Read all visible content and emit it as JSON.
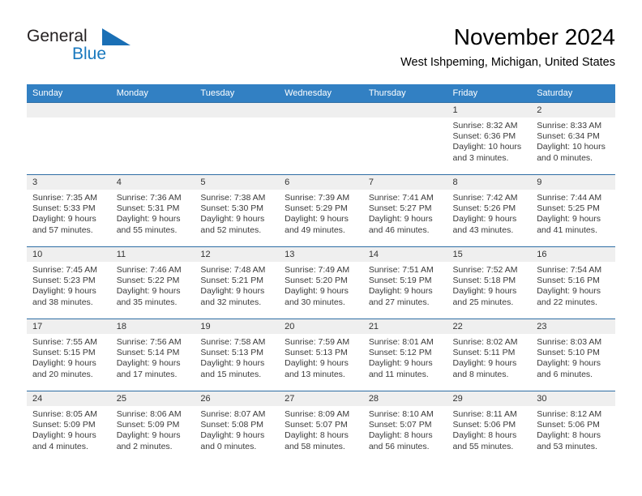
{
  "brand": {
    "name_part1": "General",
    "name_part2": "Blue",
    "mark": "triangle-logo"
  },
  "header": {
    "title": "November 2024",
    "location": "West Ishpeming, Michigan, United States"
  },
  "colors": {
    "header_blue": "#3280c3",
    "row_border_blue": "#2e6da4",
    "date_band_gray": "#efefef",
    "brand_blue": "#1878be"
  },
  "weekdays": [
    "Sunday",
    "Monday",
    "Tuesday",
    "Wednesday",
    "Thursday",
    "Friday",
    "Saturday"
  ],
  "weeks": [
    [
      {
        "date": "",
        "empty": true,
        "sunrise": "",
        "sunset": "",
        "daylight": ""
      },
      {
        "date": "",
        "empty": true,
        "sunrise": "",
        "sunset": "",
        "daylight": ""
      },
      {
        "date": "",
        "empty": true,
        "sunrise": "",
        "sunset": "",
        "daylight": ""
      },
      {
        "date": "",
        "empty": true,
        "sunrise": "",
        "sunset": "",
        "daylight": ""
      },
      {
        "date": "",
        "empty": true,
        "sunrise": "",
        "sunset": "",
        "daylight": ""
      },
      {
        "date": "1",
        "empty": false,
        "sunrise": "Sunrise: 8:32 AM",
        "sunset": "Sunset: 6:36 PM",
        "daylight": "Daylight: 10 hours and 3 minutes."
      },
      {
        "date": "2",
        "empty": false,
        "sunrise": "Sunrise: 8:33 AM",
        "sunset": "Sunset: 6:34 PM",
        "daylight": "Daylight: 10 hours and 0 minutes."
      }
    ],
    [
      {
        "date": "3",
        "empty": false,
        "sunrise": "Sunrise: 7:35 AM",
        "sunset": "Sunset: 5:33 PM",
        "daylight": "Daylight: 9 hours and 57 minutes."
      },
      {
        "date": "4",
        "empty": false,
        "sunrise": "Sunrise: 7:36 AM",
        "sunset": "Sunset: 5:31 PM",
        "daylight": "Daylight: 9 hours and 55 minutes."
      },
      {
        "date": "5",
        "empty": false,
        "sunrise": "Sunrise: 7:38 AM",
        "sunset": "Sunset: 5:30 PM",
        "daylight": "Daylight: 9 hours and 52 minutes."
      },
      {
        "date": "6",
        "empty": false,
        "sunrise": "Sunrise: 7:39 AM",
        "sunset": "Sunset: 5:29 PM",
        "daylight": "Daylight: 9 hours and 49 minutes."
      },
      {
        "date": "7",
        "empty": false,
        "sunrise": "Sunrise: 7:41 AM",
        "sunset": "Sunset: 5:27 PM",
        "daylight": "Daylight: 9 hours and 46 minutes."
      },
      {
        "date": "8",
        "empty": false,
        "sunrise": "Sunrise: 7:42 AM",
        "sunset": "Sunset: 5:26 PM",
        "daylight": "Daylight: 9 hours and 43 minutes."
      },
      {
        "date": "9",
        "empty": false,
        "sunrise": "Sunrise: 7:44 AM",
        "sunset": "Sunset: 5:25 PM",
        "daylight": "Daylight: 9 hours and 41 minutes."
      }
    ],
    [
      {
        "date": "10",
        "empty": false,
        "sunrise": "Sunrise: 7:45 AM",
        "sunset": "Sunset: 5:23 PM",
        "daylight": "Daylight: 9 hours and 38 minutes."
      },
      {
        "date": "11",
        "empty": false,
        "sunrise": "Sunrise: 7:46 AM",
        "sunset": "Sunset: 5:22 PM",
        "daylight": "Daylight: 9 hours and 35 minutes."
      },
      {
        "date": "12",
        "empty": false,
        "sunrise": "Sunrise: 7:48 AM",
        "sunset": "Sunset: 5:21 PM",
        "daylight": "Daylight: 9 hours and 32 minutes."
      },
      {
        "date": "13",
        "empty": false,
        "sunrise": "Sunrise: 7:49 AM",
        "sunset": "Sunset: 5:20 PM",
        "daylight": "Daylight: 9 hours and 30 minutes."
      },
      {
        "date": "14",
        "empty": false,
        "sunrise": "Sunrise: 7:51 AM",
        "sunset": "Sunset: 5:19 PM",
        "daylight": "Daylight: 9 hours and 27 minutes."
      },
      {
        "date": "15",
        "empty": false,
        "sunrise": "Sunrise: 7:52 AM",
        "sunset": "Sunset: 5:18 PM",
        "daylight": "Daylight: 9 hours and 25 minutes."
      },
      {
        "date": "16",
        "empty": false,
        "sunrise": "Sunrise: 7:54 AM",
        "sunset": "Sunset: 5:16 PM",
        "daylight": "Daylight: 9 hours and 22 minutes."
      }
    ],
    [
      {
        "date": "17",
        "empty": false,
        "sunrise": "Sunrise: 7:55 AM",
        "sunset": "Sunset: 5:15 PM",
        "daylight": "Daylight: 9 hours and 20 minutes."
      },
      {
        "date": "18",
        "empty": false,
        "sunrise": "Sunrise: 7:56 AM",
        "sunset": "Sunset: 5:14 PM",
        "daylight": "Daylight: 9 hours and 17 minutes."
      },
      {
        "date": "19",
        "empty": false,
        "sunrise": "Sunrise: 7:58 AM",
        "sunset": "Sunset: 5:13 PM",
        "daylight": "Daylight: 9 hours and 15 minutes."
      },
      {
        "date": "20",
        "empty": false,
        "sunrise": "Sunrise: 7:59 AM",
        "sunset": "Sunset: 5:13 PM",
        "daylight": "Daylight: 9 hours and 13 minutes."
      },
      {
        "date": "21",
        "empty": false,
        "sunrise": "Sunrise: 8:01 AM",
        "sunset": "Sunset: 5:12 PM",
        "daylight": "Daylight: 9 hours and 11 minutes."
      },
      {
        "date": "22",
        "empty": false,
        "sunrise": "Sunrise: 8:02 AM",
        "sunset": "Sunset: 5:11 PM",
        "daylight": "Daylight: 9 hours and 8 minutes."
      },
      {
        "date": "23",
        "empty": false,
        "sunrise": "Sunrise: 8:03 AM",
        "sunset": "Sunset: 5:10 PM",
        "daylight": "Daylight: 9 hours and 6 minutes."
      }
    ],
    [
      {
        "date": "24",
        "empty": false,
        "sunrise": "Sunrise: 8:05 AM",
        "sunset": "Sunset: 5:09 PM",
        "daylight": "Daylight: 9 hours and 4 minutes."
      },
      {
        "date": "25",
        "empty": false,
        "sunrise": "Sunrise: 8:06 AM",
        "sunset": "Sunset: 5:09 PM",
        "daylight": "Daylight: 9 hours and 2 minutes."
      },
      {
        "date": "26",
        "empty": false,
        "sunrise": "Sunrise: 8:07 AM",
        "sunset": "Sunset: 5:08 PM",
        "daylight": "Daylight: 9 hours and 0 minutes."
      },
      {
        "date": "27",
        "empty": false,
        "sunrise": "Sunrise: 8:09 AM",
        "sunset": "Sunset: 5:07 PM",
        "daylight": "Daylight: 8 hours and 58 minutes."
      },
      {
        "date": "28",
        "empty": false,
        "sunrise": "Sunrise: 8:10 AM",
        "sunset": "Sunset: 5:07 PM",
        "daylight": "Daylight: 8 hours and 56 minutes."
      },
      {
        "date": "29",
        "empty": false,
        "sunrise": "Sunrise: 8:11 AM",
        "sunset": "Sunset: 5:06 PM",
        "daylight": "Daylight: 8 hours and 55 minutes."
      },
      {
        "date": "30",
        "empty": false,
        "sunrise": "Sunrise: 8:12 AM",
        "sunset": "Sunset: 5:06 PM",
        "daylight": "Daylight: 8 hours and 53 minutes."
      }
    ]
  ]
}
